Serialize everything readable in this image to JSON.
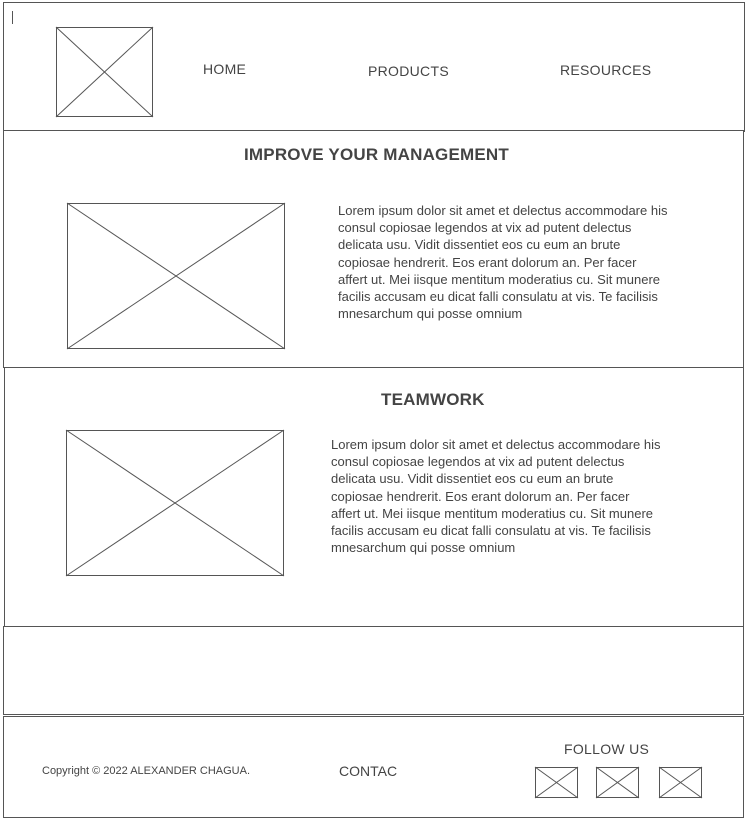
{
  "header": {
    "nav": [
      {
        "id": "home",
        "label": "HOME"
      },
      {
        "id": "products",
        "label": "PRODUCTS"
      },
      {
        "id": "resources",
        "label": "RESOURCES"
      }
    ]
  },
  "sections": [
    {
      "title": "IMPROVE YOUR MANAGEMENT",
      "body": "Lorem ipsum dolor sit amet et delectus accommodare his consul copiosae legendos at vix ad putent delectus delicata usu. Vidit dissentiet eos cu eum an brute copiosae hendrerit. Eos erant dolorum an. Per facer affert ut. Mei iisque mentitum moderatius cu. Sit munere facilis accusam eu dicat falli consulatu at vis. Te facilisis mnesarchum qui posse omnium"
    },
    {
      "title": "TEAMWORK",
      "body": "Lorem ipsum dolor sit amet et delectus accommodare his consul copiosae legendos at vix ad putent delectus delicata usu. Vidit dissentiet eos cu eum an brute copiosae hendrerit. Eos erant dolorum an. Per facer affert ut. Mei iisque mentitum moderatius cu. Sit munere facilis accusam eu dicat falli consulatu at vis. Te facilisis mnesarchum qui posse omnium"
    }
  ],
  "footer": {
    "copyright": "Copyright © 2022 ALEXANDER CHAGUA.",
    "contact": "CONTAC",
    "follow_us": "FOLLOW US"
  }
}
